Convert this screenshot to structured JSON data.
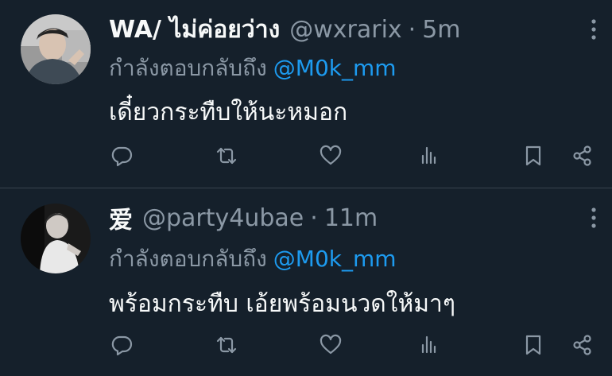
{
  "tweets": [
    {
      "display_name": "WA/ ไม่ค่อยว่าง",
      "handle": "@wxrarix",
      "dot": "·",
      "time": "5m",
      "replying_prefix": "กำลังตอบกลับถึง",
      "replying_to": "@M0k_mm",
      "text": "เดี๋ยวกระทืบให้นะหมอก"
    },
    {
      "display_name": "爱",
      "handle": "@party4ubae",
      "dot": "·",
      "time": "11m",
      "replying_prefix": "กำลังตอบกลับถึง",
      "replying_to": "@M0k_mm",
      "text": "พร้อมกระทืบ เอ้ยพร้อมนวดให้มาๆ"
    }
  ],
  "icons": {
    "reply": "reply-icon",
    "retweet": "retweet-icon",
    "like": "like-icon",
    "views": "views-icon",
    "bookmark": "bookmark-icon",
    "share": "share-icon",
    "more": "more-icon"
  },
  "colors": {
    "background": "#15202b",
    "primary_text": "#f7f9f9",
    "secondary_text": "#8b98a5",
    "accent": "#1d9bf0",
    "divider": "#38444d"
  }
}
